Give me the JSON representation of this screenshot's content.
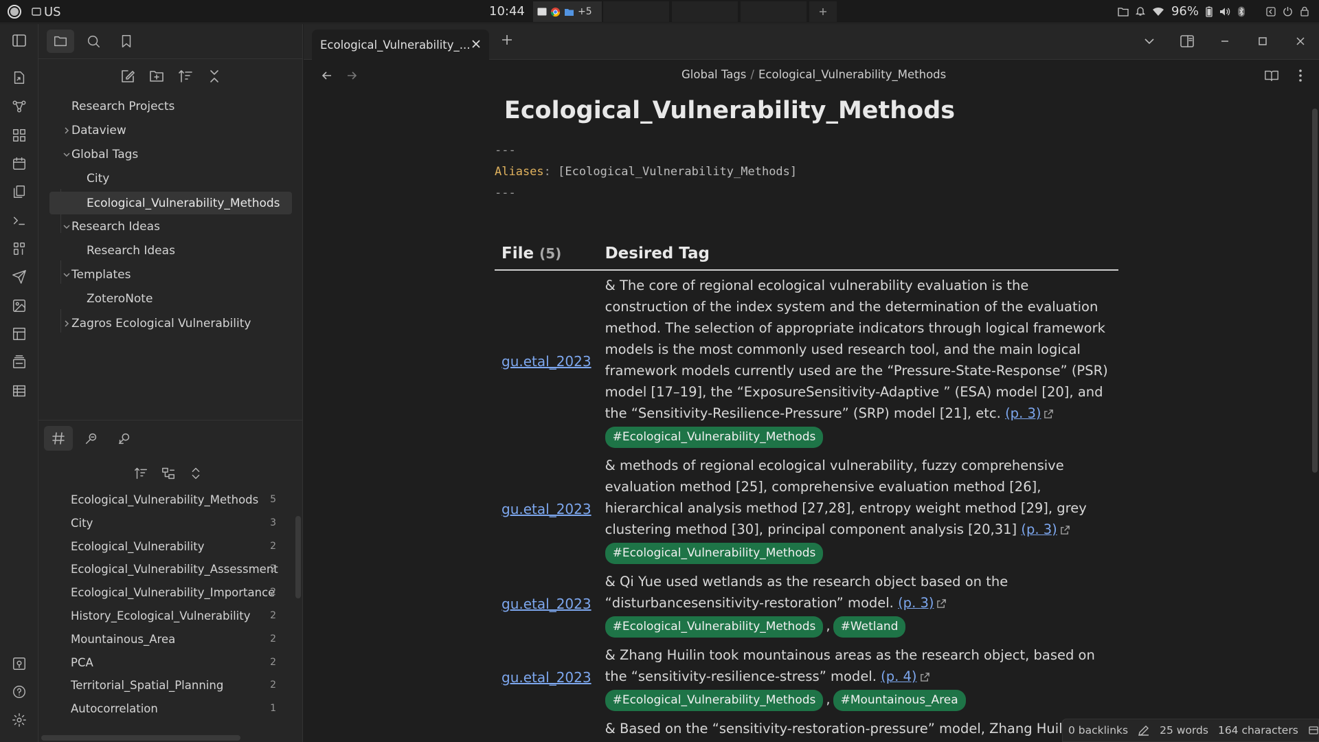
{
  "system": {
    "keyboard_layout": "US",
    "clock": "10:44",
    "tray_more": "+5",
    "battery": "96%"
  },
  "ribbon": {
    "icons": [
      "open-quick-switcher-icon",
      "graph-view-icon",
      "canvas-icon",
      "daily-note-icon",
      "templates-icon",
      "command-palette-icon",
      "workspaces-icon",
      "publish-icon",
      "image-icon",
      "kanban-icon",
      "slides-icon",
      "table-icon",
      "vault-switcher-icon",
      "help-icon",
      "settings-icon"
    ]
  },
  "file_tree": [
    {
      "label": "Research Projects",
      "level": 0,
      "type": "folder-root"
    },
    {
      "label": "Dataview",
      "level": 0,
      "type": "folder-collapsed"
    },
    {
      "label": "Global Tags",
      "level": 0,
      "type": "folder-open"
    },
    {
      "label": "City",
      "level": 1,
      "type": "file"
    },
    {
      "label": "Ecological_Vulnerability_Methods",
      "level": 1,
      "type": "file",
      "selected": true
    },
    {
      "label": "Research Ideas",
      "level": 0,
      "type": "folder-open"
    },
    {
      "label": "Research Ideas",
      "level": 1,
      "type": "file"
    },
    {
      "label": "Templates",
      "level": 0,
      "type": "folder-open"
    },
    {
      "label": "ZoteroNote",
      "level": 1,
      "type": "file"
    },
    {
      "label": "Zagros Ecological Vulnerability",
      "level": 0,
      "type": "folder-collapsed"
    }
  ],
  "tags": [
    {
      "name": "Ecological_Vulnerability_Methods",
      "count": "5"
    },
    {
      "name": "City",
      "count": "3"
    },
    {
      "name": "Ecological_Vulnerability",
      "count": "2"
    },
    {
      "name": "Ecological_Vulnerability_Assessment",
      "count": "2"
    },
    {
      "name": "Ecological_Vulnerability_Importance",
      "count": "2"
    },
    {
      "name": "History_Ecological_Vulnerability",
      "count": "2"
    },
    {
      "name": "Mountainous_Area",
      "count": "2"
    },
    {
      "name": "PCA",
      "count": "2"
    },
    {
      "name": "Territorial_Spatial_Planning",
      "count": "2"
    },
    {
      "name": "Autocorrelation",
      "count": "1"
    }
  ],
  "tab": {
    "title": "Ecological_Vulnerability_..."
  },
  "breadcrumb": {
    "parent": "Global Tags",
    "separator": "/",
    "current": "Ecological_Vulnerability_Methods"
  },
  "note": {
    "title": "Ecological_Vulnerability_Methods",
    "frontmatter": {
      "delim": "---",
      "key": "Aliases",
      "colon": ":",
      "value": "[Ecological_Vulnerability_Methods]"
    }
  },
  "table": {
    "col_file": "File",
    "file_count": "(5)",
    "col_tag": "Desired Tag",
    "rows": [
      {
        "file": "gu.etal_2023",
        "text": "& The core of regional ecological vulnerability evaluation is the construction of the index system and the determination of the evaluation method. The selection of appropriate indicators through logical framework models is the most commonly used research tool, and the main logical framework models currently used are the “Pressure-State-Response” (PSR) model [17–19], the “ExposureSensitivity-Adaptive ” (ESA) model [20], and the “Sensitivity-Resilience-Pressure” (SRP) model [21], etc.",
        "page": "(p. 3)",
        "tags": [
          "#Ecological_Vulnerability_Methods"
        ]
      },
      {
        "file": "gu.etal_2023",
        "text": "& methods of regional ecological vulnerability, fuzzy comprehensive evaluation method [25], comprehensive evaluation method [26], hierarchical analysis method [27,28], entropy weight method [29], grey clustering method [30], principal component analysis [20,31]",
        "page": "(p. 3)",
        "tags": [
          "#Ecological_Vulnerability_Methods"
        ]
      },
      {
        "file": "gu.etal_2023",
        "text": "& Qi Yue used wetlands as the research object based on the “disturbancesensitivity-restoration” model.",
        "page": "(p. 3)",
        "tags": [
          "#Ecological_Vulnerability_Methods",
          "#Wetland"
        ]
      },
      {
        "file": "gu.etal_2023",
        "text": "& Zhang Huilin took mountainous areas as the research object, based on the “sensitivity-resilience-stress” model.",
        "page": "(p. 4)",
        "tags": [
          "#Ecological_Vulnerability_Methods",
          "#Mountainous_Area"
        ]
      },
      {
        "file": "",
        "text": "& Based on the “sensitivity-restoration-pressure” model, Zhang Huilin constructed an ecological vulnerability evaluation index system and",
        "page": "",
        "tags": []
      }
    ]
  },
  "status": {
    "backlinks": "0 backlinks",
    "words": "25 words",
    "characters": "164 characters"
  }
}
